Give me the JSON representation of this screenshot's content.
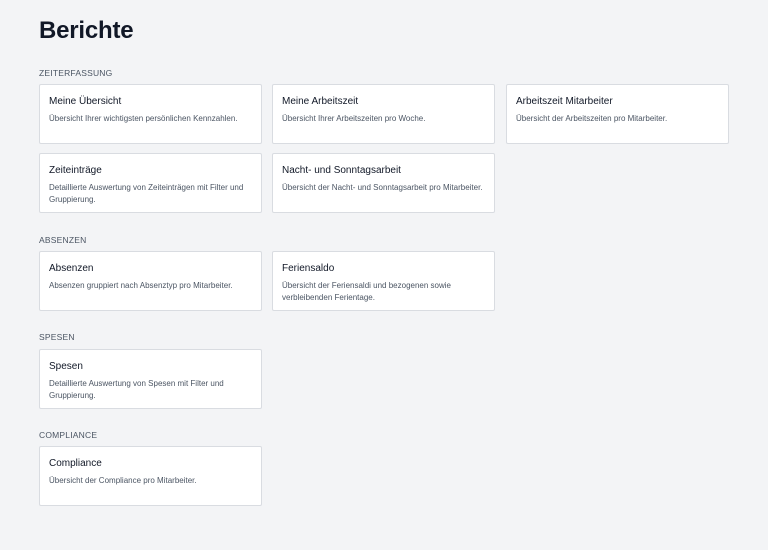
{
  "page": {
    "title": "Berichte"
  },
  "sections": {
    "zeiterfassung": {
      "label": "ZEITERFASSUNG",
      "cards": [
        {
          "title": "Meine Übersicht",
          "description": "Übersicht Ihrer wichtigsten persönlichen Kennzahlen."
        },
        {
          "title": "Meine Arbeitszeit",
          "description": "Übersicht Ihrer Arbeitszeiten pro Woche."
        },
        {
          "title": "Arbeitszeit Mitarbeiter",
          "description": "Übersicht der Arbeitszeiten pro Mitarbeiter."
        },
        {
          "title": "Zeiteinträge",
          "description": "Detaillierte Auswertung von Zeiteinträgen mit Filter und Gruppierung."
        },
        {
          "title": "Nacht- und Sonntagsarbeit",
          "description": "Übersicht der Nacht- und Sonntagsarbeit pro Mitarbeiter."
        }
      ]
    },
    "absenzen": {
      "label": "ABSENZEN",
      "cards": [
        {
          "title": "Absenzen",
          "description": "Absenzen gruppiert nach Absenztyp pro Mitarbeiter."
        },
        {
          "title": "Feriensaldo",
          "description": "Übersicht der Feriensaldi und bezogenen sowie verbleibenden Ferientage."
        }
      ]
    },
    "spesen": {
      "label": "SPESEN",
      "cards": [
        {
          "title": "Spesen",
          "description": "Detaillierte Auswertung von Spesen mit Filter und Gruppierung."
        }
      ]
    },
    "compliance": {
      "label": "COMPLIANCE",
      "cards": [
        {
          "title": "Compliance",
          "description": "Übersicht der Compliance pro Mitarbeiter."
        }
      ]
    }
  }
}
